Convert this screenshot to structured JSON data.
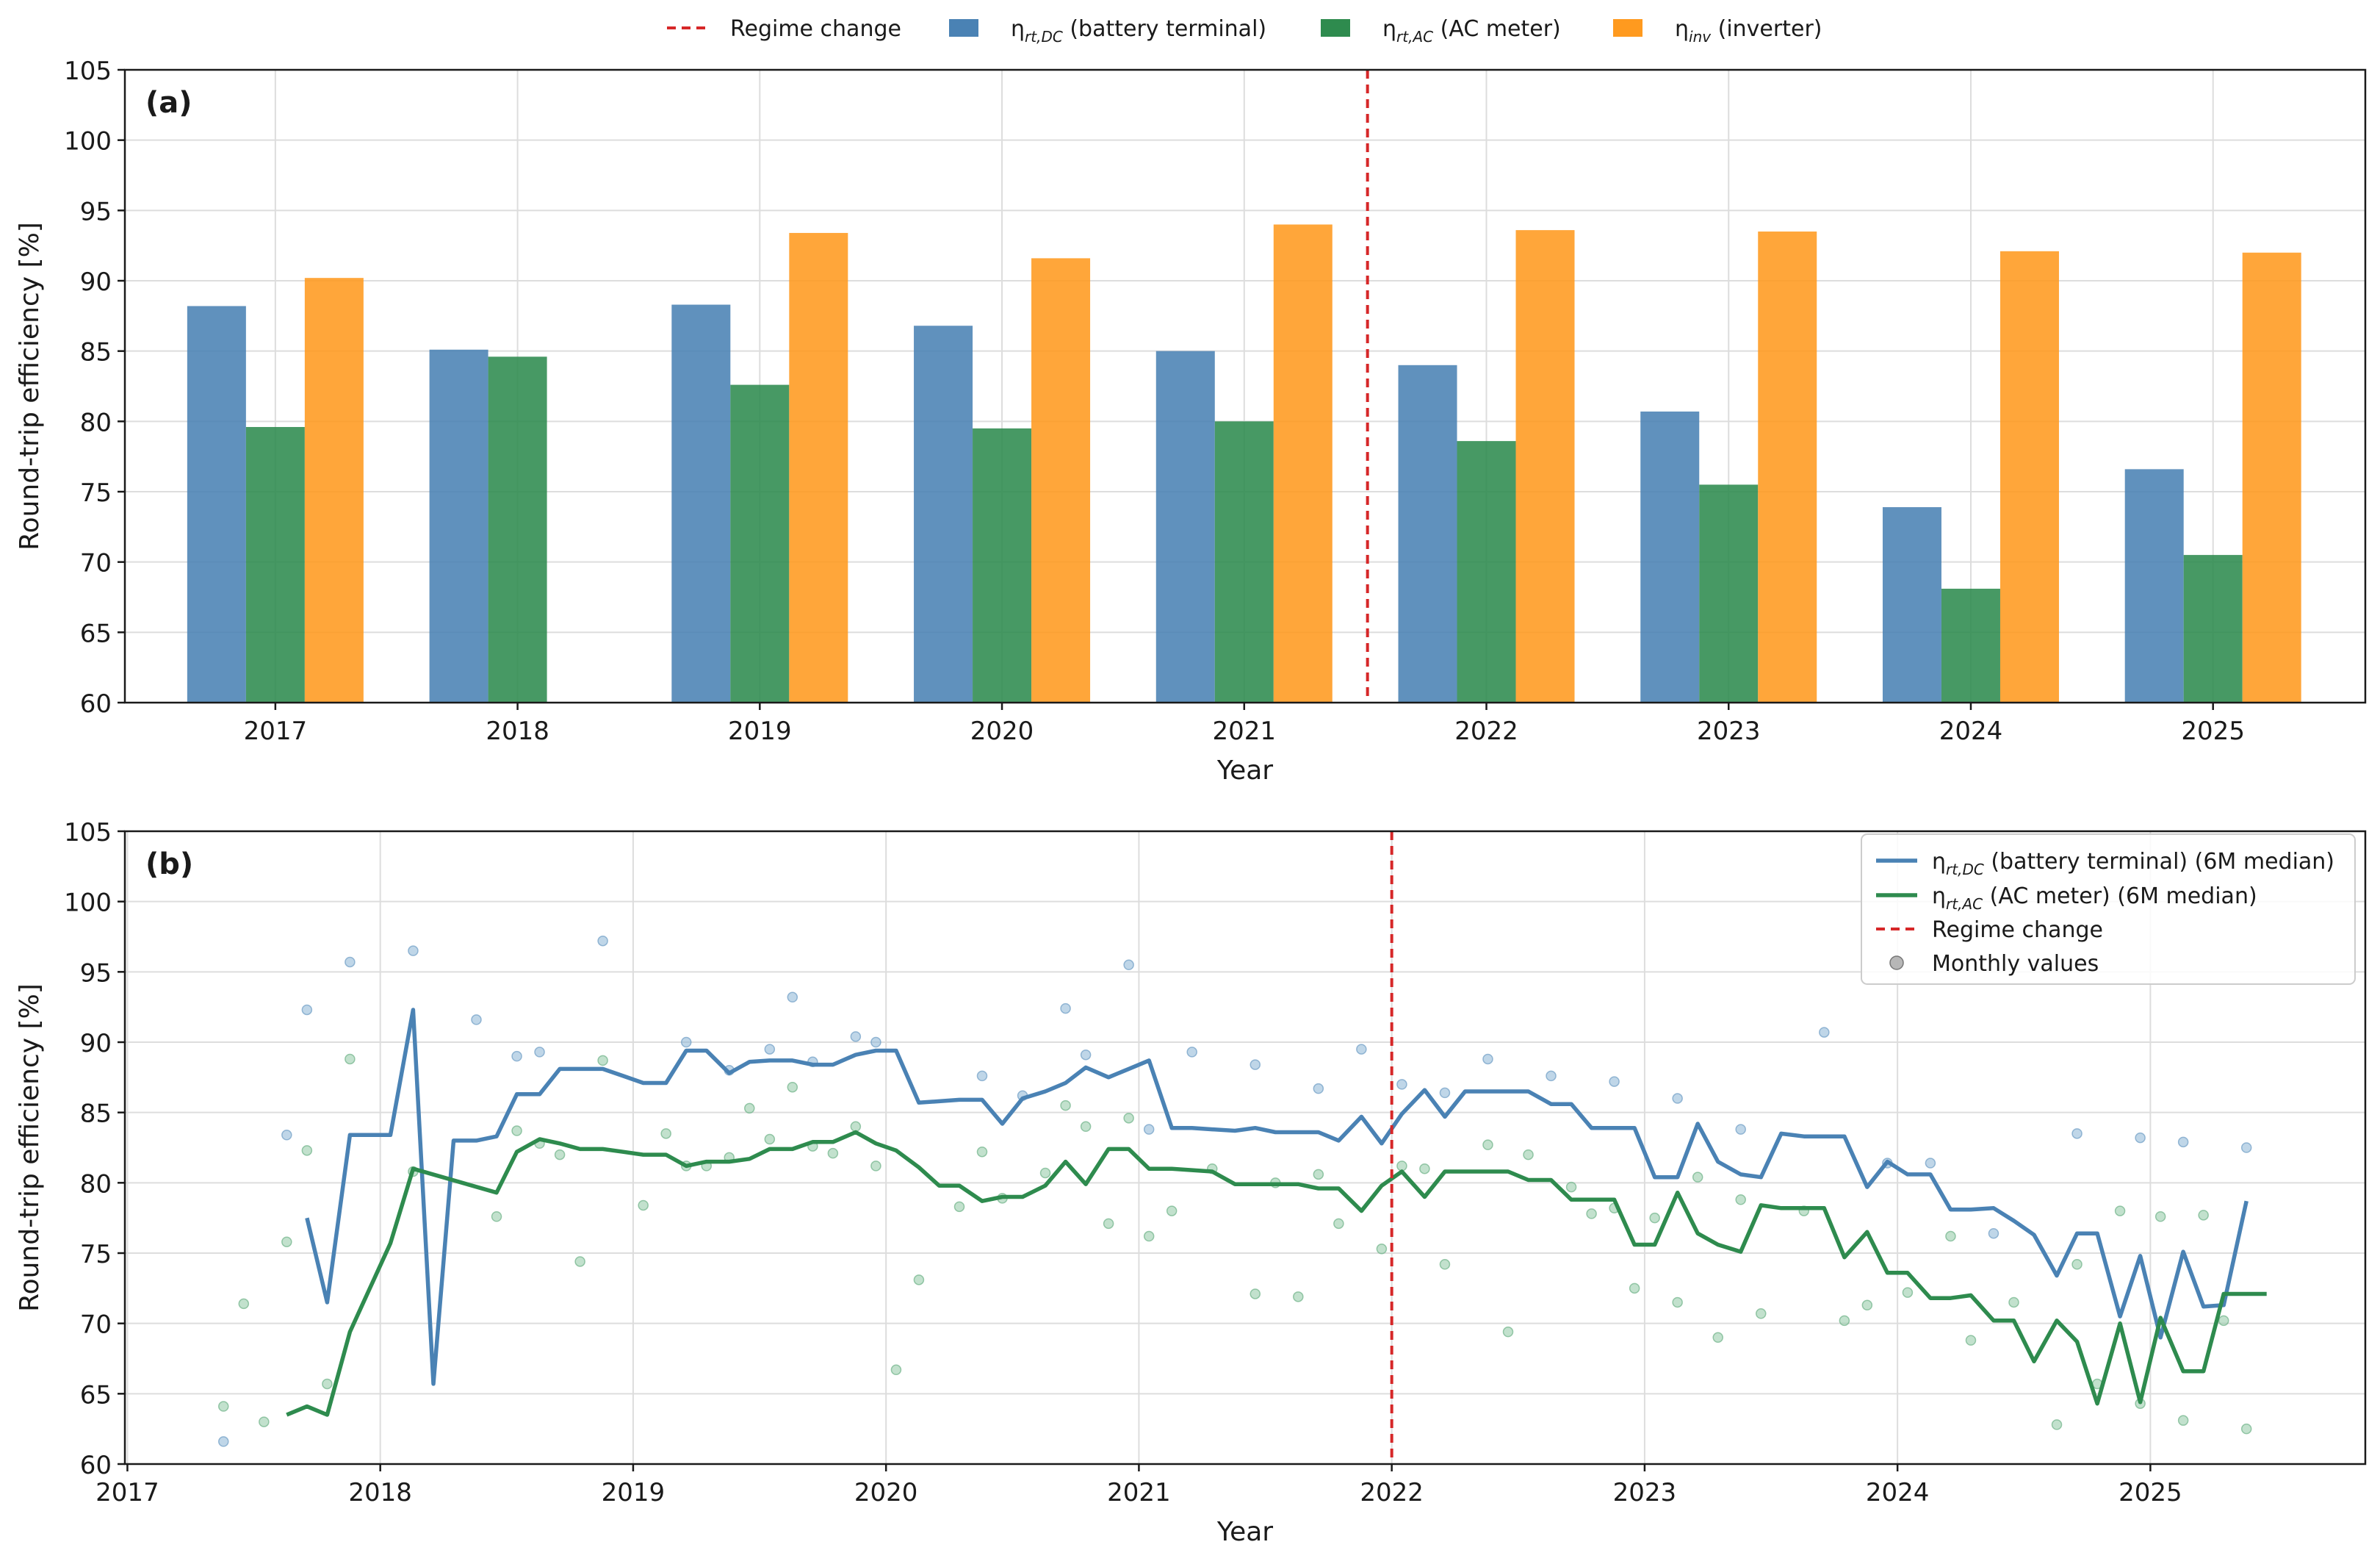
{
  "legend_top": {
    "regime": "Regime change",
    "dc": {
      "sym": "η",
      "sub": "rt,DC",
      "txt": " (battery terminal)"
    },
    "ac": {
      "sym": "η",
      "sub": "rt,AC",
      "txt": " (AC meter)"
    },
    "inv": {
      "sym": "η",
      "sub": "inv",
      "txt": " (inverter)"
    }
  },
  "legend_b": {
    "dc": {
      "sym": "η",
      "sub": "rt,DC",
      "txt": " (battery terminal) (6M median)"
    },
    "ac": {
      "sym": "η",
      "sub": "rt,AC",
      "txt": " (AC meter) (6M median)"
    },
    "regime": "Regime change",
    "monthly": "Monthly values"
  },
  "colors": {
    "dc": "#4a82b4",
    "ac": "#2e8b4e",
    "inv": "#ff9a1f",
    "regime": "#d62728",
    "grid": "#dddddd"
  },
  "chart_data": [
    {
      "type": "bar",
      "panel_label": "(a)",
      "xlabel": "Year",
      "ylabel": "Round-trip efficiency [%]",
      "ylim": [
        60,
        105
      ],
      "yticks": [
        60,
        65,
        70,
        75,
        80,
        85,
        90,
        95,
        100,
        105
      ],
      "categories": [
        "2017",
        "2018",
        "2019",
        "2020",
        "2021",
        "2022",
        "2023",
        "2024",
        "2025"
      ],
      "regime_change_between": [
        "2021",
        "2022"
      ],
      "grid": true,
      "series": [
        {
          "name": "η_rt,DC (battery terminal)",
          "key": "dc",
          "values": [
            88.2,
            85.1,
            88.3,
            86.8,
            85.0,
            84.0,
            80.7,
            73.9,
            76.6
          ]
        },
        {
          "name": "η_rt,AC (AC meter)",
          "key": "ac",
          "values": [
            79.6,
            84.6,
            82.6,
            79.5,
            80.0,
            78.6,
            75.5,
            68.1,
            70.5
          ]
        },
        {
          "name": "η_inv (inverter)",
          "key": "inv",
          "values": [
            90.2,
            null,
            93.4,
            91.6,
            94.0,
            93.6,
            93.5,
            92.1,
            92.0
          ]
        }
      ]
    },
    {
      "type": "line",
      "panel_label": "(b)",
      "xlabel": "Year",
      "ylabel": "Round-trip efficiency [%]",
      "ylim": [
        60,
        105
      ],
      "xlim": [
        2016.99,
        2025.85
      ],
      "yticks": [
        60,
        65,
        70,
        75,
        80,
        85,
        90,
        95,
        100,
        105
      ],
      "xticks": [
        2017,
        2018,
        2019,
        2020,
        2021,
        2022,
        2023,
        2024,
        2025
      ],
      "xtick_labels": [
        "2017",
        "2018",
        "2019",
        "2020",
        "2021",
        "2022",
        "2023",
        "2024",
        "2025"
      ],
      "regime_change_x": 2022.0,
      "legend_position": "upper right",
      "grid": true,
      "series": [
        {
          "name": "η_rt,DC (battery terminal) (6M median)",
          "key": "dc",
          "x": [
            2017.71,
            2017.79,
            2017.88,
            2017.96,
            2018.04,
            2018.13,
            2018.21,
            2018.29,
            2018.38,
            2018.46,
            2018.54,
            2018.63,
            2018.71,
            2018.79,
            2018.88,
            2018.96,
            2019.04,
            2019.13,
            2019.21,
            2019.29,
            2019.38,
            2019.46,
            2019.54,
            2019.63,
            2019.71,
            2019.79,
            2019.88,
            2019.96,
            2020.04,
            2020.13,
            2020.21,
            2020.29,
            2020.38,
            2020.46,
            2020.54,
            2020.63,
            2020.71,
            2020.79,
            2020.88,
            2020.96,
            2021.04,
            2021.13,
            2021.21,
            2021.29,
            2021.38,
            2021.46,
            2021.54,
            2021.63,
            2021.71,
            2021.79,
            2021.88,
            2021.96,
            2022.04,
            2022.13,
            2022.21,
            2022.29,
            2022.38,
            2022.46,
            2022.54,
            2022.63,
            2022.71,
            2022.79,
            2022.88,
            2022.96,
            2023.04,
            2023.13,
            2023.21,
            2023.29,
            2023.38,
            2023.46,
            2023.54,
            2023.63,
            2023.71,
            2023.79,
            2023.88,
            2023.96,
            2024.04,
            2024.13,
            2024.21,
            2024.29,
            2024.38,
            2024.46,
            2024.54,
            2024.63,
            2024.71,
            2024.79,
            2024.88,
            2024.96,
            2025.04,
            2025.13,
            2025.21,
            2025.29,
            2025.38
          ],
          "values": [
            77.5,
            71.5,
            83.4,
            83.4,
            83.4,
            92.3,
            65.7,
            83.0,
            83.0,
            83.3,
            86.3,
            86.3,
            88.1,
            88.1,
            88.1,
            87.6,
            87.1,
            87.1,
            89.4,
            89.4,
            87.8,
            88.6,
            88.7,
            88.7,
            88.4,
            88.4,
            89.1,
            89.4,
            89.4,
            85.7,
            85.8,
            85.9,
            85.9,
            84.2,
            86.0,
            86.5,
            87.1,
            88.2,
            87.5,
            88.1,
            88.7,
            83.9,
            83.9,
            83.8,
            83.7,
            83.9,
            83.6,
            83.6,
            83.6,
            83.0,
            84.7,
            82.8,
            84.9,
            86.6,
            84.7,
            86.5,
            86.5,
            86.5,
            86.5,
            85.6,
            85.6,
            83.9,
            83.9,
            83.9,
            80.4,
            80.4,
            84.2,
            81.5,
            80.6,
            80.4,
            83.5,
            83.3,
            83.3,
            83.3,
            79.7,
            81.5,
            80.6,
            80.6,
            78.1,
            78.1,
            78.2,
            77.3,
            76.3,
            73.4,
            76.4,
            76.4,
            70.5,
            74.8,
            69.0,
            75.1,
            71.2,
            71.3,
            78.7
          ]
        },
        {
          "name": "η_rt,AC (AC meter) (6M median)",
          "key": "ac",
          "x": [
            2017.63,
            2017.71,
            2017.79,
            2017.88,
            2018.04,
            2018.13,
            2018.46,
            2018.54,
            2018.63,
            2018.71,
            2018.79,
            2018.88,
            2018.96,
            2019.04,
            2019.13,
            2019.21,
            2019.29,
            2019.38,
            2019.46,
            2019.54,
            2019.63,
            2019.71,
            2019.79,
            2019.88,
            2019.96,
            2020.04,
            2020.13,
            2020.21,
            2020.29,
            2020.38,
            2020.46,
            2020.54,
            2020.63,
            2020.71,
            2020.79,
            2020.88,
            2020.96,
            2021.04,
            2021.13,
            2021.21,
            2021.29,
            2021.38,
            2021.46,
            2021.54,
            2021.63,
            2021.71,
            2021.79,
            2021.88,
            2021.96,
            2022.04,
            2022.13,
            2022.21,
            2022.29,
            2022.38,
            2022.46,
            2022.54,
            2022.63,
            2022.71,
            2022.79,
            2022.88,
            2022.96,
            2023.04,
            2023.13,
            2023.21,
            2023.29,
            2023.38,
            2023.46,
            2023.54,
            2023.63,
            2023.71,
            2023.79,
            2023.88,
            2023.96,
            2024.04,
            2024.13,
            2024.21,
            2024.29,
            2024.38,
            2024.46,
            2024.54,
            2024.63,
            2024.71,
            2024.79,
            2024.88,
            2024.96,
            2025.04,
            2025.13,
            2025.21,
            2025.29,
            2025.38,
            2025.46
          ],
          "values": [
            63.5,
            64.1,
            63.5,
            69.4,
            75.7,
            81.0,
            79.3,
            82.2,
            83.1,
            82.8,
            82.4,
            82.4,
            82.2,
            82.0,
            82.0,
            81.2,
            81.5,
            81.5,
            81.7,
            82.4,
            82.4,
            82.9,
            82.9,
            83.6,
            82.8,
            82.3,
            81.1,
            79.8,
            79.8,
            78.7,
            79.0,
            79.0,
            79.8,
            81.5,
            79.9,
            82.4,
            82.4,
            81.0,
            81.0,
            80.9,
            80.8,
            79.9,
            79.9,
            79.9,
            79.9,
            79.6,
            79.6,
            78.0,
            79.8,
            80.8,
            79.0,
            80.8,
            80.8,
            80.8,
            80.8,
            80.2,
            80.2,
            78.8,
            78.8,
            78.8,
            75.6,
            75.6,
            79.3,
            76.4,
            75.6,
            75.1,
            78.4,
            78.2,
            78.2,
            78.2,
            74.7,
            76.5,
            73.6,
            73.6,
            71.8,
            71.8,
            72.0,
            70.2,
            70.2,
            67.3,
            70.2,
            68.7,
            64.3,
            70.0,
            64.4,
            70.4,
            66.6,
            66.6,
            72.1,
            72.1,
            72.1
          ]
        },
        {
          "name": "Monthly values",
          "key": "monthly_dc",
          "marker": "dot",
          "x": [
            2017.38,
            2017.63,
            2017.71,
            2017.88,
            2018.13,
            2018.38,
            2018.54,
            2018.63,
            2018.88,
            2019.21,
            2019.38,
            2019.54,
            2019.63,
            2019.71,
            2019.88,
            2019.96,
            2020.38,
            2020.54,
            2020.71,
            2020.79,
            2020.96,
            2021.04,
            2021.21,
            2021.46,
            2021.71,
            2021.88,
            2022.04,
            2022.21,
            2022.38,
            2022.63,
            2022.88,
            2023.13,
            2023.38,
            2023.71,
            2023.96,
            2024.13,
            2024.38,
            2024.71,
            2024.96,
            2025.13,
            2025.38
          ],
          "values": [
            61.6,
            83.4,
            92.3,
            95.7,
            96.5,
            91.6,
            89.0,
            89.3,
            97.2,
            90.0,
            88.0,
            89.5,
            93.2,
            88.6,
            90.4,
            90.0,
            87.6,
            86.2,
            92.4,
            89.1,
            95.5,
            83.8,
            89.3,
            88.4,
            86.7,
            89.5,
            87.0,
            86.4,
            88.8,
            87.6,
            87.2,
            86.0,
            83.8,
            90.7,
            81.4,
            81.4,
            76.4,
            83.5,
            83.2,
            82.9,
            82.5
          ]
        },
        {
          "name": "Monthly values",
          "key": "monthly_ac",
          "marker": "dot",
          "x": [
            2017.38,
            2017.46,
            2017.54,
            2017.63,
            2017.71,
            2017.79,
            2017.88,
            2018.13,
            2018.46,
            2018.54,
            2018.63,
            2018.71,
            2018.79,
            2018.88,
            2019.04,
            2019.13,
            2019.21,
            2019.29,
            2019.38,
            2019.46,
            2019.54,
            2019.63,
            2019.71,
            2019.79,
            2019.88,
            2019.96,
            2020.04,
            2020.13,
            2020.29,
            2020.38,
            2020.46,
            2020.63,
            2020.71,
            2020.79,
            2020.88,
            2020.96,
            2021.04,
            2021.13,
            2021.29,
            2021.46,
            2021.54,
            2021.63,
            2021.71,
            2021.79,
            2021.96,
            2022.04,
            2022.13,
            2022.21,
            2022.38,
            2022.46,
            2022.54,
            2022.71,
            2022.79,
            2022.88,
            2022.96,
            2023.04,
            2023.13,
            2023.21,
            2023.29,
            2023.38,
            2023.46,
            2023.63,
            2023.79,
            2023.88,
            2024.04,
            2024.21,
            2024.29,
            2024.46,
            2024.63,
            2024.71,
            2024.79,
            2024.88,
            2024.96,
            2025.04,
            2025.13,
            2025.21,
            2025.29,
            2025.38
          ],
          "values": [
            64.1,
            71.4,
            63.0,
            75.8,
            82.3,
            65.7,
            88.8,
            80.8,
            77.6,
            83.7,
            82.8,
            82.0,
            74.4,
            88.7,
            78.4,
            83.5,
            81.2,
            81.2,
            81.8,
            85.3,
            83.1,
            86.8,
            82.6,
            82.1,
            84.0,
            81.2,
            66.7,
            73.1,
            78.3,
            82.2,
            78.9,
            80.7,
            85.5,
            84.0,
            77.1,
            84.6,
            76.2,
            78.0,
            81.0,
            72.1,
            80.0,
            71.9,
            80.6,
            77.1,
            75.3,
            81.2,
            81.0,
            74.2,
            82.7,
            69.4,
            82.0,
            79.7,
            77.8,
            78.2,
            72.5,
            77.5,
            71.5,
            80.4,
            69.0,
            78.8,
            70.7,
            78.0,
            70.2,
            71.3,
            72.2,
            76.2,
            68.8,
            71.5,
            62.8,
            74.2,
            65.7,
            78.0,
            64.3,
            77.6,
            63.1,
            77.7,
            70.2,
            62.5
          ]
        }
      ]
    }
  ]
}
